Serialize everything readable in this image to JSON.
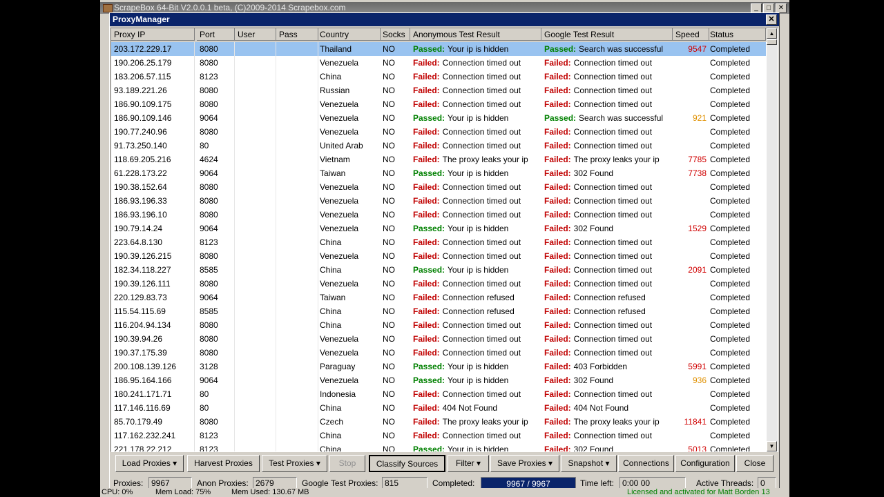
{
  "app": {
    "title": "ScrapeBox 64-Bit V2.0.0.1 beta, (C)2009-2014 Scrapebox.com",
    "min_glyph": "_",
    "max_glyph": "□",
    "close_glyph": "✕"
  },
  "window": {
    "title": "ProxyManager",
    "close_glyph": "✕"
  },
  "columns": [
    {
      "key": "ip",
      "label": "Proxy IP"
    },
    {
      "key": "port",
      "label": "Port"
    },
    {
      "key": "user",
      "label": "User"
    },
    {
      "key": "pass",
      "label": "Pass"
    },
    {
      "key": "country",
      "label": "Country"
    },
    {
      "key": "socks",
      "label": "Socks"
    },
    {
      "key": "anon",
      "label": "Anonymous Test Result"
    },
    {
      "key": "google",
      "label": "Google Test Result"
    },
    {
      "key": "speed",
      "label": "Speed"
    },
    {
      "key": "status",
      "label": "Status"
    }
  ],
  "rows": [
    {
      "ip": "203.172.229.17",
      "port": "8080",
      "country": "Thailand",
      "socks": "NO",
      "anon_label": "Passed:",
      "anon_text": "Your ip is hidden",
      "google_label": "Passed:",
      "google_text": "Search was successful",
      "speed": "9547",
      "speed_color": "red",
      "status": "Completed",
      "selected": true
    },
    {
      "ip": "190.206.25.179",
      "port": "8080",
      "country": "Venezuela",
      "socks": "NO",
      "anon_label": "Failed:",
      "anon_text": "Connection timed out",
      "google_label": "Failed:",
      "google_text": "Connection timed out",
      "speed": "",
      "status": "Completed"
    },
    {
      "ip": "183.206.57.115",
      "port": "8123",
      "country": "China",
      "socks": "NO",
      "anon_label": "Failed:",
      "anon_text": "Connection timed out",
      "google_label": "Failed:",
      "google_text": "Connection timed out",
      "speed": "",
      "status": "Completed"
    },
    {
      "ip": "93.189.221.26",
      "port": "8080",
      "country": "Russian",
      "socks": "NO",
      "anon_label": "Failed:",
      "anon_text": "Connection timed out",
      "google_label": "Failed:",
      "google_text": "Connection timed out",
      "speed": "",
      "status": "Completed"
    },
    {
      "ip": "186.90.109.175",
      "port": "8080",
      "country": "Venezuela",
      "socks": "NO",
      "anon_label": "Failed:",
      "anon_text": "Connection timed out",
      "google_label": "Failed:",
      "google_text": "Connection timed out",
      "speed": "",
      "status": "Completed"
    },
    {
      "ip": "186.90.109.146",
      "port": "9064",
      "country": "Venezuela",
      "socks": "NO",
      "anon_label": "Passed:",
      "anon_text": "Your ip is hidden",
      "google_label": "Passed:",
      "google_text": "Search was successful",
      "speed": "921",
      "speed_color": "orange",
      "status": "Completed"
    },
    {
      "ip": "190.77.240.96",
      "port": "8080",
      "country": "Venezuela",
      "socks": "NO",
      "anon_label": "Failed:",
      "anon_text": "Connection timed out",
      "google_label": "Failed:",
      "google_text": "Connection timed out",
      "speed": "",
      "status": "Completed"
    },
    {
      "ip": "91.73.250.140",
      "port": "80",
      "country": "United Arab",
      "socks": "NO",
      "anon_label": "Failed:",
      "anon_text": "Connection timed out",
      "google_label": "Failed:",
      "google_text": "Connection timed out",
      "speed": "",
      "status": "Completed"
    },
    {
      "ip": "118.69.205.216",
      "port": "4624",
      "country": "Vietnam",
      "socks": "NO",
      "anon_label": "Failed:",
      "anon_text": "The proxy leaks your ip",
      "google_label": "Failed:",
      "google_text": "The proxy leaks your ip",
      "speed": "7785",
      "speed_color": "red",
      "status": "Completed"
    },
    {
      "ip": "61.228.173.22",
      "port": "9064",
      "country": "Taiwan",
      "socks": "NO",
      "anon_label": "Passed:",
      "anon_text": "Your ip is hidden",
      "google_label": "Failed:",
      "google_text": "302 Found",
      "speed": "7738",
      "speed_color": "red",
      "status": "Completed"
    },
    {
      "ip": "190.38.152.64",
      "port": "8080",
      "country": "Venezuela",
      "socks": "NO",
      "anon_label": "Failed:",
      "anon_text": "Connection timed out",
      "google_label": "Failed:",
      "google_text": "Connection timed out",
      "speed": "",
      "status": "Completed"
    },
    {
      "ip": "186.93.196.33",
      "port": "8080",
      "country": "Venezuela",
      "socks": "NO",
      "anon_label": "Failed:",
      "anon_text": "Connection timed out",
      "google_label": "Failed:",
      "google_text": "Connection timed out",
      "speed": "",
      "status": "Completed"
    },
    {
      "ip": "186.93.196.10",
      "port": "8080",
      "country": "Venezuela",
      "socks": "NO",
      "anon_label": "Failed:",
      "anon_text": "Connection timed out",
      "google_label": "Failed:",
      "google_text": "Connection timed out",
      "speed": "",
      "status": "Completed"
    },
    {
      "ip": "190.79.14.24",
      "port": "9064",
      "country": "Venezuela",
      "socks": "NO",
      "anon_label": "Passed:",
      "anon_text": "Your ip is hidden",
      "google_label": "Failed:",
      "google_text": "302 Found",
      "speed": "1529",
      "speed_color": "red",
      "status": "Completed"
    },
    {
      "ip": "223.64.8.130",
      "port": "8123",
      "country": "China",
      "socks": "NO",
      "anon_label": "Failed:",
      "anon_text": "Connection timed out",
      "google_label": "Failed:",
      "google_text": "Connection timed out",
      "speed": "",
      "status": "Completed"
    },
    {
      "ip": "190.39.126.215",
      "port": "8080",
      "country": "Venezuela",
      "socks": "NO",
      "anon_label": "Failed:",
      "anon_text": "Connection timed out",
      "google_label": "Failed:",
      "google_text": "Connection timed out",
      "speed": "",
      "status": "Completed"
    },
    {
      "ip": "182.34.118.227",
      "port": "8585",
      "country": "China",
      "socks": "NO",
      "anon_label": "Passed:",
      "anon_text": "Your ip is hidden",
      "google_label": "Failed:",
      "google_text": "Connection timed out",
      "speed": "2091",
      "speed_color": "red",
      "status": "Completed"
    },
    {
      "ip": "190.39.126.111",
      "port": "8080",
      "country": "Venezuela",
      "socks": "NO",
      "anon_label": "Failed:",
      "anon_text": "Connection timed out",
      "google_label": "Failed:",
      "google_text": "Connection timed out",
      "speed": "",
      "status": "Completed"
    },
    {
      "ip": "220.129.83.73",
      "port": "9064",
      "country": "Taiwan",
      "socks": "NO",
      "anon_label": "Failed:",
      "anon_text": "Connection refused",
      "google_label": "Failed:",
      "google_text": "Connection refused",
      "speed": "",
      "status": "Completed"
    },
    {
      "ip": "115.54.115.69",
      "port": "8585",
      "country": "China",
      "socks": "NO",
      "anon_label": "Failed:",
      "anon_text": "Connection refused",
      "google_label": "Failed:",
      "google_text": "Connection refused",
      "speed": "",
      "status": "Completed"
    },
    {
      "ip": "116.204.94.134",
      "port": "8080",
      "country": "China",
      "socks": "NO",
      "anon_label": "Failed:",
      "anon_text": "Connection timed out",
      "google_label": "Failed:",
      "google_text": "Connection timed out",
      "speed": "",
      "status": "Completed"
    },
    {
      "ip": "190.39.94.26",
      "port": "8080",
      "country": "Venezuela",
      "socks": "NO",
      "anon_label": "Failed:",
      "anon_text": "Connection timed out",
      "google_label": "Failed:",
      "google_text": "Connection timed out",
      "speed": "",
      "status": "Completed"
    },
    {
      "ip": "190.37.175.39",
      "port": "8080",
      "country": "Venezuela",
      "socks": "NO",
      "anon_label": "Failed:",
      "anon_text": "Connection timed out",
      "google_label": "Failed:",
      "google_text": "Connection timed out",
      "speed": "",
      "status": "Completed"
    },
    {
      "ip": "200.108.139.126",
      "port": "3128",
      "country": "Paraguay",
      "socks": "NO",
      "anon_label": "Passed:",
      "anon_text": "Your ip is hidden",
      "google_label": "Failed:",
      "google_text": "403 Forbidden",
      "speed": "5991",
      "speed_color": "red",
      "status": "Completed"
    },
    {
      "ip": "186.95.164.166",
      "port": "9064",
      "country": "Venezuela",
      "socks": "NO",
      "anon_label": "Passed:",
      "anon_text": "Your ip is hidden",
      "google_label": "Failed:",
      "google_text": "302 Found",
      "speed": "936",
      "speed_color": "orange",
      "status": "Completed"
    },
    {
      "ip": "180.241.171.71",
      "port": "80",
      "country": "Indonesia",
      "socks": "NO",
      "anon_label": "Failed:",
      "anon_text": "Connection timed out",
      "google_label": "Failed:",
      "google_text": "Connection timed out",
      "speed": "",
      "status": "Completed"
    },
    {
      "ip": "117.146.116.69",
      "port": "80",
      "country": "China",
      "socks": "NO",
      "anon_label": "Failed:",
      "anon_text": "404 Not Found",
      "google_label": "Failed:",
      "google_text": "404 Not Found",
      "speed": "",
      "status": "Completed"
    },
    {
      "ip": "85.70.179.49",
      "port": "8080",
      "country": "Czech",
      "socks": "NO",
      "anon_label": "Failed:",
      "anon_text": "The proxy leaks your ip",
      "google_label": "Failed:",
      "google_text": "The proxy leaks your ip",
      "speed": "11841",
      "speed_color": "red",
      "status": "Completed"
    },
    {
      "ip": "117.162.232.241",
      "port": "8123",
      "country": "China",
      "socks": "NO",
      "anon_label": "Failed:",
      "anon_text": "Connection timed out",
      "google_label": "Failed:",
      "google_text": "Connection timed out",
      "speed": "",
      "status": "Completed"
    },
    {
      "ip": "221.178.22.212",
      "port": "8123",
      "country": "China",
      "socks": "NO",
      "anon_label": "Passed:",
      "anon_text": "Your ip is hidden",
      "google_label": "Failed:",
      "google_text": "302 Found",
      "speed": "5013",
      "speed_color": "red",
      "status": "Completed"
    }
  ],
  "buttons": [
    {
      "name": "load-proxies-button",
      "label": "Load Proxies",
      "dropdown": true
    },
    {
      "name": "harvest-proxies-button",
      "label": "Harvest Proxies",
      "dropdown": false
    },
    {
      "name": "test-proxies-button",
      "label": "Test Proxies",
      "dropdown": true
    },
    {
      "name": "stop-button",
      "label": "Stop",
      "dropdown": false,
      "disabled": true
    },
    {
      "name": "classify-sources-button",
      "label": "Classify Sources",
      "dropdown": false,
      "pressed": true
    },
    {
      "name": "filter-button",
      "label": "Filter",
      "dropdown": true
    },
    {
      "name": "save-proxies-button",
      "label": "Save Proxies",
      "dropdown": true
    },
    {
      "name": "snapshot-button",
      "label": "Snapshot",
      "dropdown": true
    },
    {
      "name": "connections-button",
      "label": "Connections",
      "dropdown": false
    },
    {
      "name": "configuration-button",
      "label": "Configuration",
      "dropdown": false
    },
    {
      "name": "close-button",
      "label": "Close",
      "dropdown": false
    }
  ],
  "status": {
    "proxies_label": "Proxies:",
    "proxies_value": "9967",
    "anon_label": "Anon Proxies:",
    "anon_value": "2679",
    "google_label": "Google Test Proxies:",
    "google_value": "815",
    "completed_label": "Completed:",
    "completed_value": "9967 / 9967",
    "completed_fraction": 1.0,
    "time_label": "Time left:",
    "time_value": "0:00 00",
    "threads_label": "Active Threads:",
    "threads_value": "0"
  },
  "footer": {
    "cpu": "CPU: 0%",
    "mem_load": "Mem Load: 75%",
    "mem_used": "Mem Used: 130.67 MB",
    "license": "Licensed and activated for Matt Borden 13"
  },
  "colors": {
    "pass": "#008000",
    "fail": "#c00000",
    "speed_red": "#d00000",
    "speed_orange": "#e09000",
    "title_bar": "#0a246a",
    "selected_row": "#99c3f0"
  }
}
